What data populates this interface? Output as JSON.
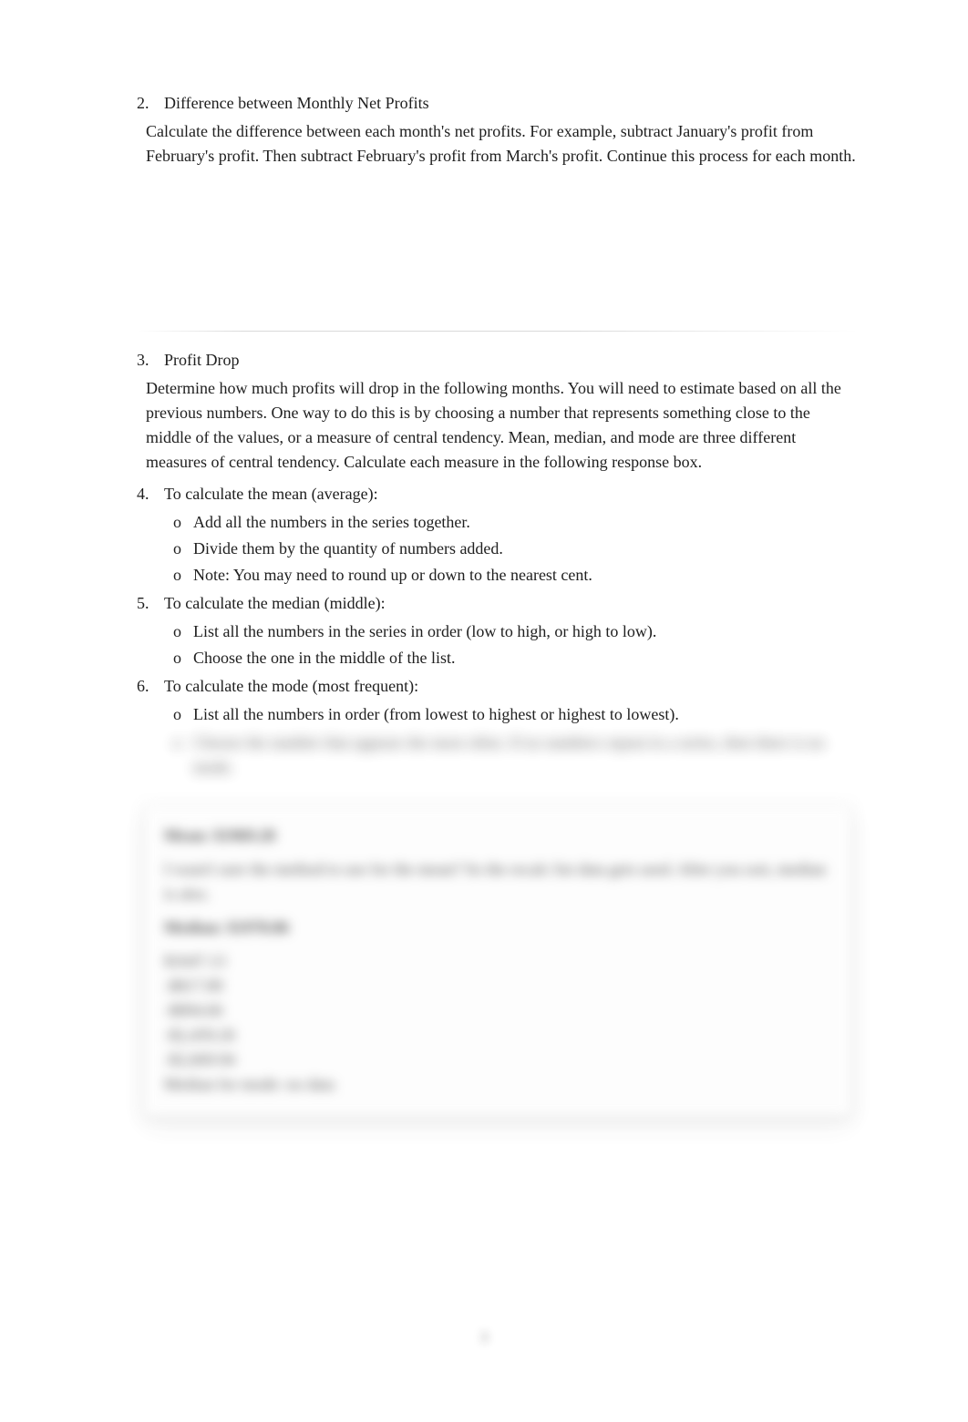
{
  "items": [
    {
      "num": "2.",
      "title": "Difference between Monthly Net Profits",
      "body": "Calculate the difference between each month's net profits. For example, subtract January's profit from February's profit. Then subtract February's profit from March's profit. Continue this process for each month."
    },
    {
      "num": "3.",
      "title": "Profit Drop",
      "body": "Determine how much profits will drop in the following months. You will need to estimate based on all the previous numbers. One way to do this is by choosing a number that represents something close to the middle of the values, or a measure of central tendency. Mean, median, and mode are three different measures of central tendency. Calculate each measure in the following response box."
    },
    {
      "num": "4.",
      "title": "To calculate the mean (average):",
      "bullets": [
        "Add all the numbers in the series together.",
        "Divide them by the quantity of numbers added.",
        "Note: You may need to round up or down to the nearest cent."
      ]
    },
    {
      "num": "5.",
      "title": "To calculate the median (middle):",
      "bullets": [
        "List all the numbers in the series in order (low to high, or high to low).",
        "Choose the one in the middle of the list."
      ]
    },
    {
      "num": "6.",
      "title": "To calculate the mode (most frequent):",
      "bullets": [
        "List all the numbers in order (from lowest to highest or highest to lowest)."
      ],
      "blurred_bullets": [
        "Choose the number that appears the most often. If no numbers repeat in a series, then there is no mode."
      ]
    }
  ],
  "bullet_marker": "o",
  "panel": {
    "head1": "Mean: $1969.28",
    "desc": "I wasn't sure the method to use for the mean? So the recalc list data gets used. After you sort, median is also.",
    "head2": "Median: $1978.86",
    "rows": [
      "$1647.13",
      "-$817.89",
      "-$894.66",
      "-$2,459.26",
      "-$2,669.94",
      "Median for mode: no data"
    ]
  },
  "page_number": "3"
}
